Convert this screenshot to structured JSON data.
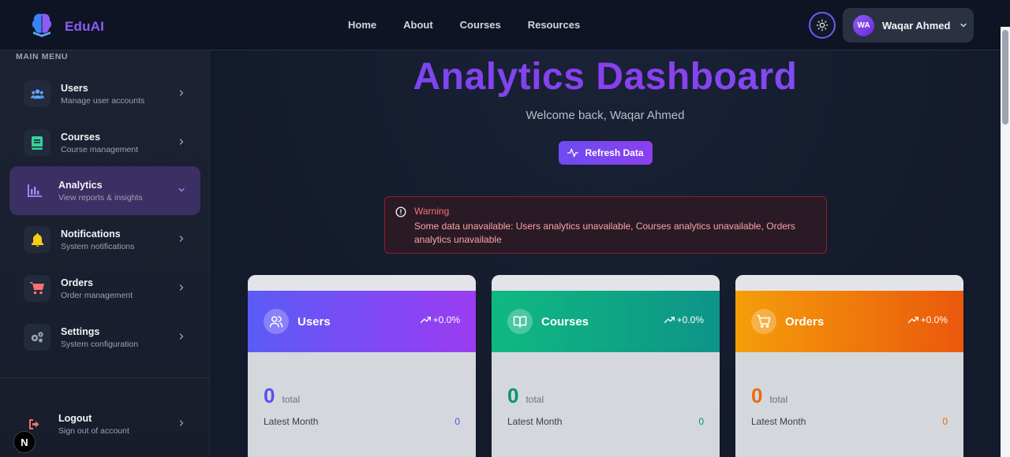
{
  "navbar": {
    "brand": "EduAI",
    "links": [
      "Home",
      "About",
      "Courses",
      "Resources"
    ],
    "user": {
      "initials": "WA",
      "name": "Waqar Ahmed"
    }
  },
  "sidebar": {
    "title": "MAIN MENU",
    "items": [
      {
        "label": "Users",
        "sub": "Manage user accounts",
        "icon": "users-icon",
        "color": "#60a5fa"
      },
      {
        "label": "Courses",
        "sub": "Course management",
        "icon": "book-icon",
        "color": "#34d399"
      },
      {
        "label": "Analytics",
        "sub": "View reports & insights",
        "icon": "chart-icon",
        "color": "#a78bfa",
        "active": true
      },
      {
        "label": "Notifications",
        "sub": "System notifications",
        "icon": "bell-icon",
        "color": "#facc15"
      },
      {
        "label": "Orders",
        "sub": "Order management",
        "icon": "cart-icon",
        "color": "#f87171"
      },
      {
        "label": "Settings",
        "sub": "System configuration",
        "icon": "gears-icon",
        "color": "#9ca3af"
      }
    ],
    "logout": {
      "label": "Logout",
      "sub": "Sign out of account"
    },
    "badge": "N"
  },
  "main": {
    "title": "Analytics Dashboard",
    "welcome": "Welcome back, Waqar Ahmed",
    "refresh_label": "Refresh Data",
    "warning": {
      "title": "Warning",
      "message": "Some data unavailable: Users analytics unavailable, Courses analytics unavailable, Orders analytics unavailable"
    },
    "cards": [
      {
        "title": "Users",
        "change": "+0.0%",
        "value": "0",
        "total_label": "total",
        "month_label": "Latest Month",
        "month_value": "0",
        "accent": "#5b4ef0"
      },
      {
        "title": "Courses",
        "change": "+0.0%",
        "value": "0",
        "total_label": "total",
        "month_label": "Latest Month",
        "month_value": "0",
        "accent": "#059669"
      },
      {
        "title": "Orders",
        "change": "+0.0%",
        "value": "0",
        "total_label": "total",
        "month_label": "Latest Month",
        "month_value": "0",
        "accent": "#ea6a0c"
      }
    ]
  }
}
